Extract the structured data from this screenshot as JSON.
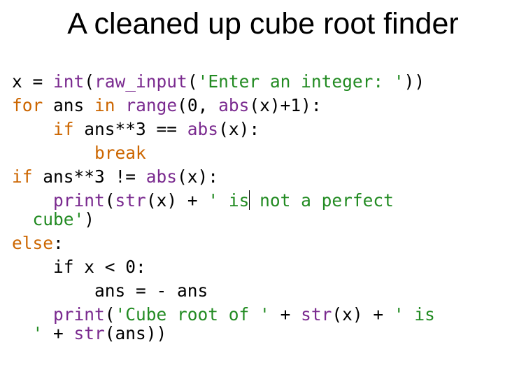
{
  "slide": {
    "title": "A cleaned up cube root finder"
  },
  "code": {
    "colors": {
      "keyword": "#cc6600",
      "builtin": "#7a2a8f",
      "string": "#228b22",
      "plain": "#000000"
    },
    "lines": [
      [
        {
          "t": "x = ",
          "c": "plain"
        },
        {
          "t": "int",
          "c": "builtin"
        },
        {
          "t": "(",
          "c": "plain"
        },
        {
          "t": "raw_input",
          "c": "builtin"
        },
        {
          "t": "(",
          "c": "plain"
        },
        {
          "t": "'Enter an integer: '",
          "c": "string"
        },
        {
          "t": "))",
          "c": "plain"
        }
      ],
      [
        {
          "t": "for",
          "c": "keyword"
        },
        {
          "t": " ans ",
          "c": "plain"
        },
        {
          "t": "in",
          "c": "keyword"
        },
        {
          "t": " ",
          "c": "plain"
        },
        {
          "t": "range",
          "c": "builtin"
        },
        {
          "t": "(0, ",
          "c": "plain"
        },
        {
          "t": "abs",
          "c": "builtin"
        },
        {
          "t": "(x)+1):",
          "c": "plain"
        }
      ],
      [
        {
          "t": "    ",
          "c": "plain"
        },
        {
          "t": "if",
          "c": "keyword"
        },
        {
          "t": " ans**3 == ",
          "c": "plain"
        },
        {
          "t": "abs",
          "c": "builtin"
        },
        {
          "t": "(x):",
          "c": "plain"
        }
      ],
      [
        {
          "t": "        ",
          "c": "plain"
        },
        {
          "t": "break",
          "c": "keyword"
        }
      ],
      [
        {
          "t": "if",
          "c": "keyword"
        },
        {
          "t": " ans**3 != ",
          "c": "plain"
        },
        {
          "t": "abs",
          "c": "builtin"
        },
        {
          "t": "(x):",
          "c": "plain"
        }
      ],
      [
        {
          "t": "    ",
          "c": "plain"
        },
        {
          "t": "print",
          "c": "builtin"
        },
        {
          "t": "(",
          "c": "plain"
        },
        {
          "t": "str",
          "c": "builtin"
        },
        {
          "t": "(x) + ",
          "c": "plain"
        },
        {
          "t": "' is",
          "c": "string"
        },
        {
          "t": "|",
          "c": "cursor"
        },
        {
          "t": " not a perfect",
          "c": "string"
        }
      ],
      [
        {
          "t": "  cube'",
          "c": "string"
        },
        {
          "t": ")",
          "c": "plain"
        }
      ],
      [
        {
          "t": "else",
          "c": "keyword"
        },
        {
          "t": ":",
          "c": "plain"
        }
      ],
      [
        {
          "t": "    if x < 0:",
          "c": "plain"
        }
      ],
      [
        {
          "t": "        ans = - ans",
          "c": "plain"
        }
      ],
      [
        {
          "t": "    ",
          "c": "plain"
        },
        {
          "t": "print",
          "c": "builtin"
        },
        {
          "t": "(",
          "c": "plain"
        },
        {
          "t": "'Cube root of '",
          "c": "string"
        },
        {
          "t": " + ",
          "c": "plain"
        },
        {
          "t": "str",
          "c": "builtin"
        },
        {
          "t": "(x) + ",
          "c": "plain"
        },
        {
          "t": "' is",
          "c": "string"
        }
      ],
      [
        {
          "t": "  '",
          "c": "string"
        },
        {
          "t": " + ",
          "c": "plain"
        },
        {
          "t": "str",
          "c": "builtin"
        },
        {
          "t": "(ans))",
          "c": "plain"
        }
      ]
    ]
  }
}
